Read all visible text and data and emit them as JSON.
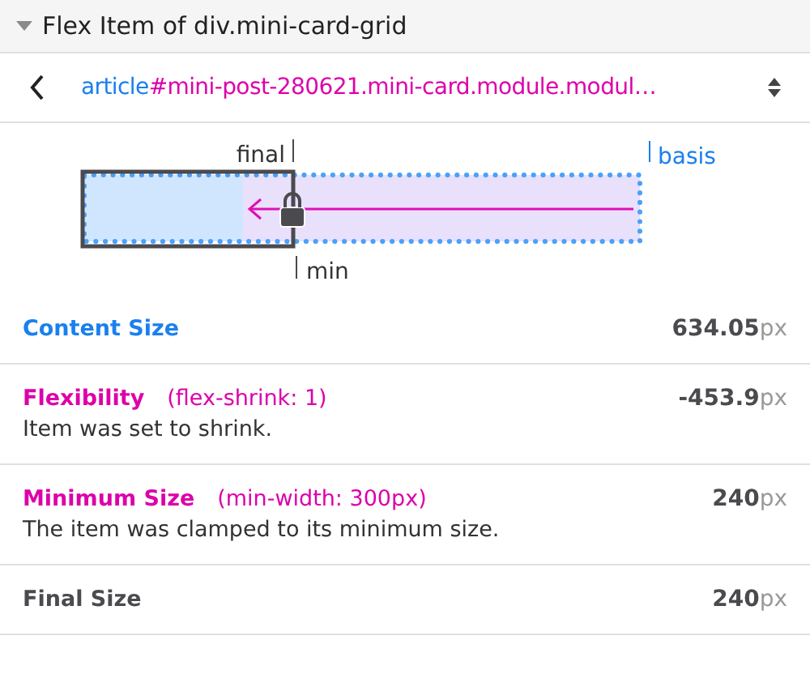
{
  "header": {
    "title": "Flex Item of div.mini-card-grid",
    "expanded": true
  },
  "selector": {
    "tag": "article",
    "rest": "#mini-post-280621.mini-card.module.modul…"
  },
  "diagram": {
    "final_label": "final",
    "basis_label": "basis",
    "min_label": "min",
    "clamped": true
  },
  "rows": [
    {
      "kind": "content",
      "label": "Content Size",
      "value": "**634.05**px"
    },
    {
      "kind": "flexibility",
      "label": "Flexibility",
      "detail": "(flex-shrink: 1)",
      "note": "Item was set to shrink.",
      "value": "**-453.9**px"
    },
    {
      "kind": "minimum",
      "label": "Minimum Size",
      "detail": "(min-width: 300px)",
      "note": "The item was clamped to its minimum size.",
      "value": "**240**px"
    },
    {
      "kind": "final",
      "label": "Final Size",
      "value": "**240**px"
    }
  ]
}
